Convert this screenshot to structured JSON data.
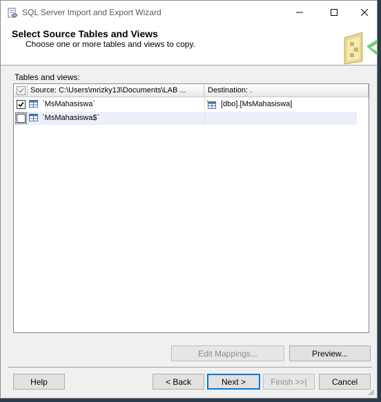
{
  "window": {
    "title": "SQL Server Import and Export Wizard"
  },
  "header": {
    "title": "Select Source Tables and Views",
    "subtitle": "Choose one or more tables and views to copy."
  },
  "grid": {
    "label": "Tables and views:",
    "columns": {
      "source": "Source: C:\\Users\\mrizky13\\Documents\\LAB ...",
      "destination": "Destination: ."
    },
    "rows": [
      {
        "checked": true,
        "source": "`MsMahasiswa`",
        "destination": "[dbo].[MsMahasiswa]"
      },
      {
        "checked": false,
        "source": "`MsMahasiswa$`",
        "destination": ""
      }
    ]
  },
  "buttons": {
    "edit_mappings": "Edit Mappings...",
    "preview": "Preview...",
    "help": "Help",
    "back": "< Back",
    "next": "Next >",
    "finish": "Finish >>|",
    "cancel": "Cancel"
  },
  "icons": {
    "app": "wizard-app-icon",
    "table": "table-icon",
    "destination_table": "new-table-icon",
    "header_graphic": "database-cube-icon"
  },
  "colors": {
    "accent": "#0078d7",
    "row_alt": "#eaf0f8",
    "disabled_text": "#8d8d8d"
  }
}
